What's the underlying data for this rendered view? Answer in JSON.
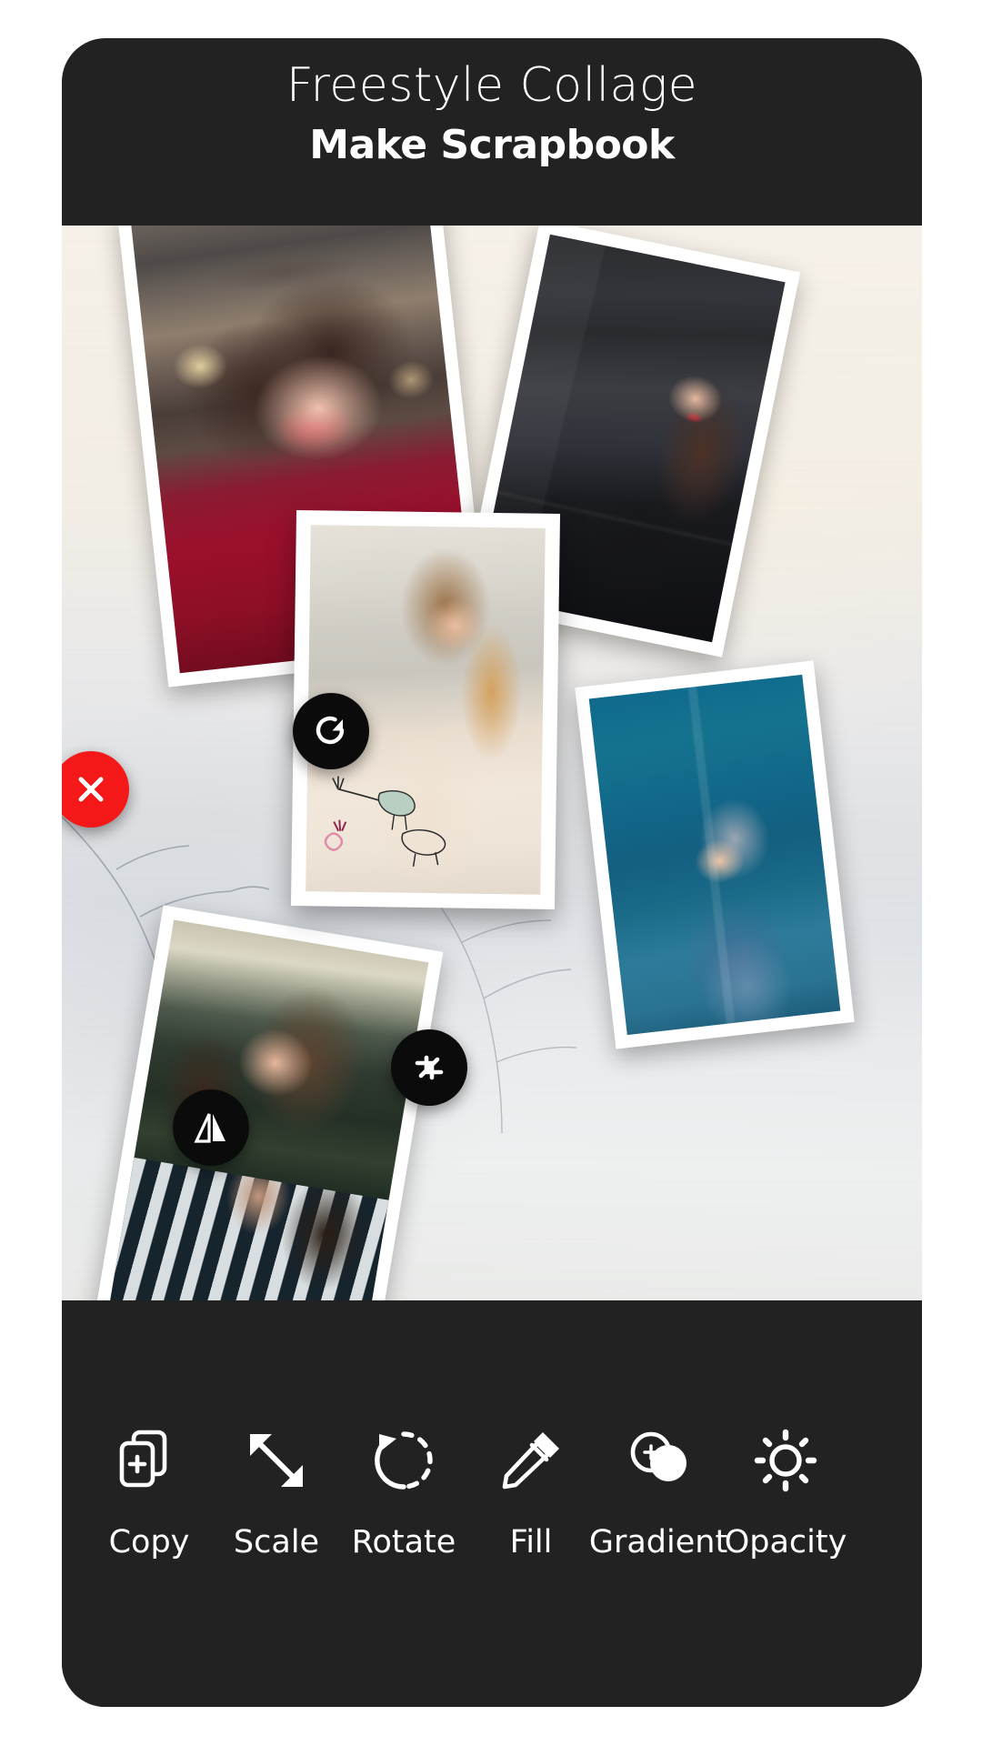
{
  "header": {
    "title": "Freestyle Collage",
    "subtitle": "Make Scrapbook"
  },
  "colors": {
    "panel": "#222222",
    "handle_dark": "#0b0b0b",
    "delete_red": "#f51818",
    "text": "#ffffff"
  },
  "canvas": {
    "name": "collage-canvas",
    "photos": [
      {
        "id": "photo-red",
        "subject": "smiling woman in red turtleneck",
        "selected": false
      },
      {
        "id": "photo-leather",
        "subject": "woman in black leather jacket",
        "selected": false
      },
      {
        "id": "photo-center",
        "subject": "woman in cream embroidered dress",
        "selected": true
      },
      {
        "id": "photo-striped",
        "subject": "woman in navy striped shirt",
        "selected": false
      },
      {
        "id": "photo-blue",
        "subject": "woman in denim jacket on blue wall",
        "selected": false
      }
    ],
    "handles": [
      {
        "id": "delete",
        "icon": "close-icon",
        "tooltip": "Delete"
      },
      {
        "id": "rotate",
        "icon": "rotate-icon",
        "tooltip": "Rotate"
      },
      {
        "id": "resize",
        "icon": "resize-icon",
        "tooltip": "Resize"
      },
      {
        "id": "flip",
        "icon": "flip-icon",
        "tooltip": "Flip"
      }
    ]
  },
  "toolbar": {
    "items": [
      {
        "label": "Copy",
        "icon": "copy-icon"
      },
      {
        "label": "Scale",
        "icon": "scale-arrows-icon"
      },
      {
        "label": "Rotate",
        "icon": "rotate-dashed-icon"
      },
      {
        "label": "Fill",
        "icon": "eyedropper-icon"
      },
      {
        "label": "Gradient",
        "icon": "gradient-circles-icon"
      },
      {
        "label": "Opacity",
        "icon": "brightness-icon"
      }
    ]
  }
}
